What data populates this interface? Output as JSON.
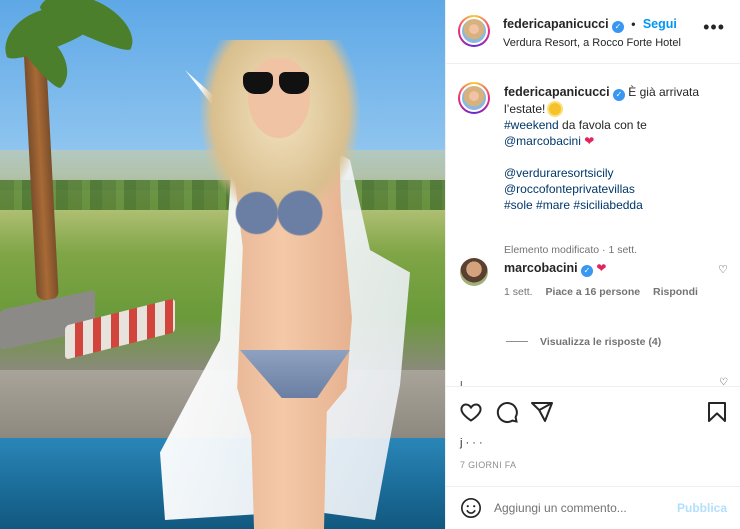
{
  "post": {
    "username": "federicapanicucci",
    "follow_label": "Segui",
    "location": "Verdura Resort, a Rocco Forte Hotel",
    "more_label": "•••"
  },
  "caption": {
    "username": "federicapanicucci",
    "text_1": "È già arrivata l’estate!",
    "tag_weekend": "#weekend",
    "text_2": " da favola con te",
    "mention_1": "@marcobacini",
    "mention_2": "@verduraresortsicily",
    "mention_3": "@roccofonteprivatevillas",
    "tag_sole": "#sole",
    "tag_mare": "#mare",
    "tag_siciliabedda": "#siciliabedda",
    "meta": "Elemento modificato · 1 sett."
  },
  "comment": {
    "username": "marcobacini",
    "time": "1 sett.",
    "likes": "Piace a 16 persone",
    "reply": "Rispondi",
    "view_replies": "Visualizza le risposte (4)"
  },
  "footer": {
    "likes_line": "j                              ·   ·   ·",
    "date": "7 GIORNI FA"
  },
  "add_comment": {
    "placeholder": "Aggiungi un commento...",
    "publish_label": "Pubblica"
  },
  "colors": {
    "link": "#00376b",
    "accent": "#0095f6",
    "publish_disabled": "#b2dffc",
    "heart": "#e0245e",
    "verified": "#3897f0"
  },
  "icons": [
    "verified-badge-icon",
    "more-options-icon",
    "sun-emoji-icon",
    "red-heart-icon",
    "like-heart-icon",
    "comment-icon",
    "share-icon",
    "save-bookmark-icon",
    "emoji-icon"
  ]
}
